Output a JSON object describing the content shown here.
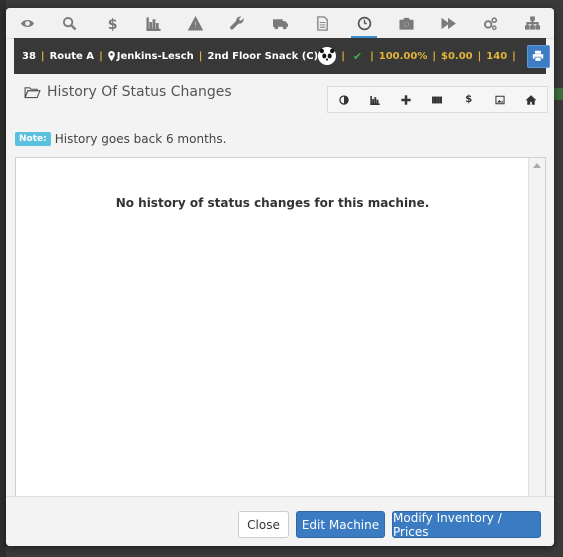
{
  "icon_bar": {
    "icons": [
      "eye-icon",
      "search-icon",
      "dollar-icon",
      "bar-chart-icon",
      "warning-icon",
      "wrench-icon",
      "truck-icon",
      "document-icon",
      "clock-icon",
      "camera-icon",
      "fast-forward-icon",
      "cogs-icon",
      "sitemap-icon"
    ],
    "active": "clock-icon"
  },
  "info_bar": {
    "machine_number": "38",
    "route": "Route A",
    "location": "Jenkins-Lesch",
    "machine_name": "2nd Floor Snack (C)",
    "percent": "100.00%",
    "amount": "$0.00",
    "count": "140",
    "separator": "|"
  },
  "panel": {
    "title": "History Of Status Changes",
    "toolbar_icons": [
      "contrast-icon",
      "bar-chart-icon",
      "plus-icon",
      "barcode-icon",
      "dollar-icon",
      "picture-icon",
      "home-icon"
    ],
    "toolbar_dollar": "$"
  },
  "note": {
    "badge": "Note:",
    "text": "History goes back 6 months."
  },
  "content": {
    "empty_message": "No history of status changes for this machine."
  },
  "footer": {
    "close_label": "Close",
    "edit_label": "Edit Machine",
    "modify_label": "Modify Inventory / Prices"
  },
  "colors": {
    "accent_blue": "#3a7bc2",
    "stat_yellow": "#e2b536",
    "check_green": "#3fae4a",
    "note_badge": "#5bc0de"
  }
}
